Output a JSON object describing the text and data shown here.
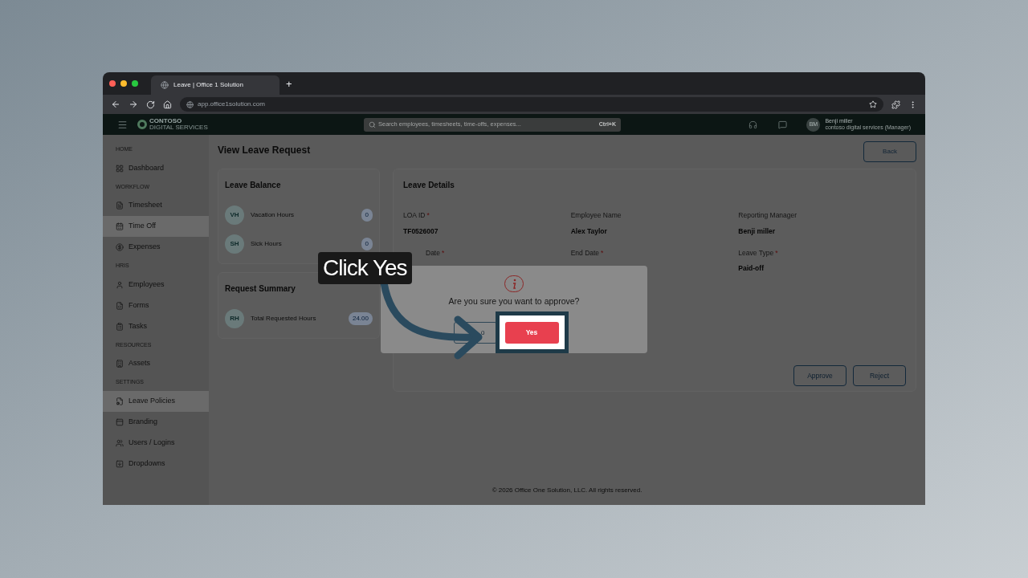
{
  "browser": {
    "tab_title": "Leave | Office 1 Solution",
    "new_tab": "+",
    "url": "app.office1solution.com"
  },
  "header": {
    "logo": "CONTOSO",
    "logo_sub": "DIGITAL SERVICES",
    "search_placeholder": "Search employees, timesheets, time-offs, expenses...",
    "shortcut": "Ctrl+K",
    "user": {
      "initials": "BM",
      "name": "Benji miller",
      "role": "contoso digital services (Manager)"
    }
  },
  "sidebar": [
    {
      "title": "HOME",
      "items": [
        {
          "label": "Dashboard",
          "selected": false
        }
      ]
    },
    {
      "title": "WORKFLOW",
      "items": [
        {
          "label": "Timesheet",
          "selected": false
        },
        {
          "label": "Time Off",
          "selected": true
        },
        {
          "label": "Expenses",
          "selected": false
        }
      ]
    },
    {
      "title": "HRIS",
      "items": [
        {
          "label": "Employees",
          "selected": false
        },
        {
          "label": "Forms",
          "selected": false
        },
        {
          "label": "Tasks",
          "selected": false
        }
      ]
    },
    {
      "title": "RESOURCES",
      "items": [
        {
          "label": "Assets",
          "selected": false
        }
      ]
    },
    {
      "title": "SETTINGS",
      "items": [
        {
          "label": "Leave Policies",
          "selected": true
        },
        {
          "label": "Branding",
          "selected": false
        },
        {
          "label": "Users / Logins",
          "selected": false
        },
        {
          "label": "Dropdowns",
          "selected": false
        }
      ]
    }
  ],
  "page": {
    "title": "View Leave Request",
    "back": "Back"
  },
  "leave_balance": {
    "title": "Leave Balance",
    "rows": [
      {
        "initials": "VH",
        "label": "Vacation Hours",
        "value": "0"
      },
      {
        "initials": "SH",
        "label": "Sick Hours",
        "value": "0"
      }
    ]
  },
  "request_summary": {
    "title": "Request Summary",
    "rows": [
      {
        "initials": "RH",
        "label": "Total Requested Hours",
        "value": "24.00"
      }
    ]
  },
  "leave_details": {
    "title": "Leave Details",
    "required_mark": "*",
    "fields": [
      {
        "label": "LOA ID",
        "required": true,
        "value": "TF0526007"
      },
      {
        "label": "Employee Name",
        "required": false,
        "value": "Alex Taylor"
      },
      {
        "label": "Reporting Manager",
        "required": false,
        "value": "Benji miller"
      },
      {
        "label": "Date",
        "required": true,
        "cut": true
      },
      {
        "label": "End Date",
        "required": true
      },
      {
        "label": "Leave Type",
        "required": true,
        "value": "Paid-off"
      }
    ],
    "actions": [
      "Approve",
      "Reject"
    ]
  },
  "footer": "© 2026 Office One Solution, LLC. All rights reserved.",
  "dialog": {
    "message": "Are you sure you want to approve?",
    "buttons": [
      {
        "label": "o",
        "kind": "secondary"
      },
      {
        "label": "Yes",
        "kind": "primary"
      }
    ]
  },
  "callout": "Click Yes"
}
